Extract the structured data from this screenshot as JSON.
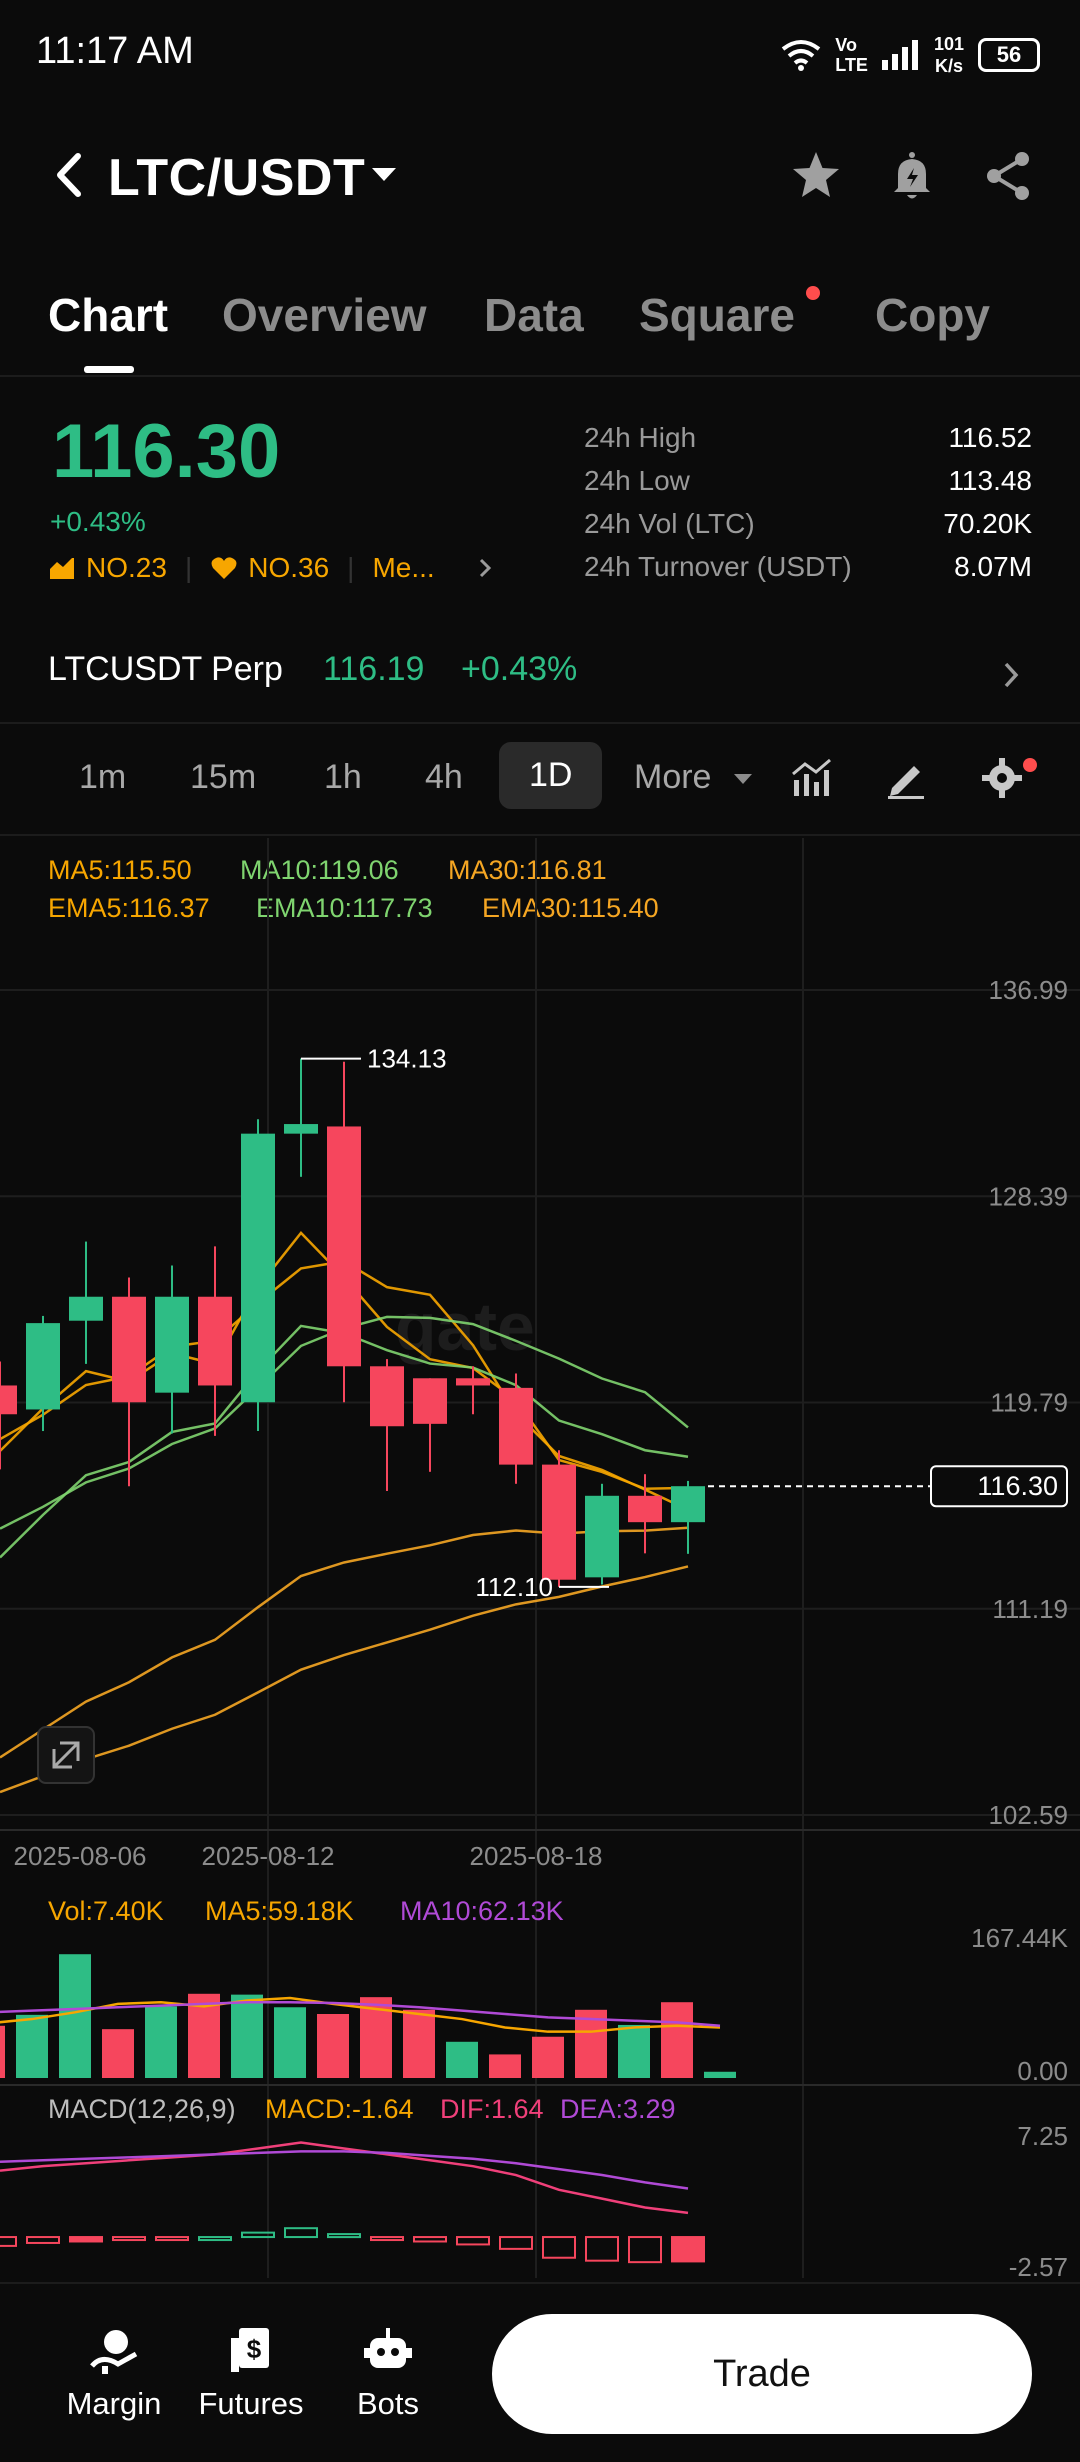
{
  "status_bar": {
    "time": "11:17 AM",
    "net_speed_value": "101",
    "net_speed_unit": "K/s",
    "volte_top": "Vo",
    "volte_bottom": "LTE",
    "battery": "56"
  },
  "header": {
    "pair": "LTC/USDT"
  },
  "tabs": [
    {
      "label": "Chart",
      "active": true
    },
    {
      "label": "Overview"
    },
    {
      "label": "Data"
    },
    {
      "label": "Square",
      "has_dot": true
    },
    {
      "label": "Copy"
    }
  ],
  "ticker": {
    "price": "116.30",
    "change": "+0.43%",
    "ranks": [
      "NO.23",
      "NO.36",
      "Me..."
    ],
    "stats": [
      {
        "label": "24h High",
        "value": "116.52"
      },
      {
        "label": "24h Low",
        "value": "113.48"
      },
      {
        "label": "24h Vol (LTC)",
        "value": "70.20K"
      },
      {
        "label": "24h Turnover (USDT)",
        "value": "8.07M"
      }
    ]
  },
  "perp": {
    "name": "LTCUSDT Perp",
    "price": "116.19",
    "change": "+0.43%"
  },
  "intervals": [
    "1m",
    "15m",
    "1h",
    "4h",
    "1D",
    "More"
  ],
  "active_interval": "1D",
  "indicators": {
    "ma5": "MA5:115.50",
    "ma10": "MA10:119.06",
    "ma30": "MA30:116.81",
    "ema5": "EMA5:116.37",
    "ema10": "EMA10:117.73",
    "ema30": "EMA30:115.40"
  },
  "chart_data": {
    "type": "candlestick",
    "y_ticks": [
      "136.99",
      "128.39",
      "119.79",
      "111.19",
      "102.59"
    ],
    "ylim": [
      102.59,
      136.99
    ],
    "x_ticks": [
      "2025-08-06",
      "2025-08-12",
      "2025-08-18"
    ],
    "high_label": "134.13",
    "low_label": "112.10",
    "last_price_label": "116.30",
    "watermark": "gate",
    "candles": [
      {
        "open": 120.5,
        "close": 119.3,
        "high": 121.5,
        "low": 117.0
      },
      {
        "open": 119.5,
        "close": 123.1,
        "high": 123.4,
        "low": 118.6
      },
      {
        "open": 123.2,
        "close": 124.2,
        "high": 126.5,
        "low": 121.4
      },
      {
        "open": 124.2,
        "close": 119.8,
        "high": 125.0,
        "low": 116.3
      },
      {
        "open": 120.2,
        "close": 124.2,
        "high": 125.5,
        "low": 118.5
      },
      {
        "open": 124.2,
        "close": 120.5,
        "high": 126.3,
        "low": 118.4
      },
      {
        "open": 119.8,
        "close": 131.0,
        "high": 131.6,
        "low": 118.6
      },
      {
        "open": 131.0,
        "close": 131.4,
        "high": 134.13,
        "low": 129.2
      },
      {
        "open": 131.3,
        "close": 121.3,
        "high": 134.0,
        "low": 119.8
      },
      {
        "open": 121.3,
        "close": 118.8,
        "high": 121.6,
        "low": 116.1
      },
      {
        "open": 120.8,
        "close": 118.9,
        "high": 120.8,
        "low": 116.9
      },
      {
        "open": 120.8,
        "close": 120.5,
        "high": 121.3,
        "low": 119.3
      },
      {
        "open": 120.4,
        "close": 117.2,
        "high": 121.0,
        "low": 116.4
      },
      {
        "open": 117.2,
        "close": 112.4,
        "high": 117.8,
        "low": 112.1
      },
      {
        "open": 112.5,
        "close": 115.9,
        "high": 116.4,
        "low": 112.2
      },
      {
        "open": 115.9,
        "close": 114.8,
        "high": 116.8,
        "low": 113.5
      },
      {
        "open": 114.8,
        "close": 116.3,
        "high": 116.52,
        "low": 113.48
      }
    ],
    "volume": {
      "labels": {
        "vol": "Vol:7.40K",
        "ma5": "MA5:59.18K",
        "ma10": "MA10:62.13K"
      },
      "y_ticks": [
        "167.44K",
        "0.00"
      ],
      "values": [
        62,
        75,
        147,
        58,
        85,
        100,
        99,
        84,
        76,
        96,
        81,
        43,
        28,
        49,
        81,
        63,
        90,
        7.4
      ],
      "up": [
        false,
        true,
        true,
        false,
        true,
        false,
        true,
        true,
        false,
        false,
        false,
        true,
        false,
        false,
        false,
        true,
        false,
        true
      ]
    },
    "macd": {
      "labels": {
        "name": "MACD(12,26,9)",
        "macd": "MACD:-1.64",
        "dif": "DIF:1.64",
        "dea": "DEA:3.29"
      },
      "y_ticks": [
        "7.25",
        "-2.57"
      ]
    }
  },
  "bottom_nav": [
    {
      "label": "Margin"
    },
    {
      "label": "Futures"
    },
    {
      "label": "Bots"
    }
  ],
  "trade_button": "Trade",
  "colors": {
    "up": "#2ebd85",
    "down": "#f6465d",
    "ma5": "#f7a600",
    "ma10": "#7fd46f",
    "ma30": "#f5a623",
    "vol_ma10": "#b04ad6"
  }
}
